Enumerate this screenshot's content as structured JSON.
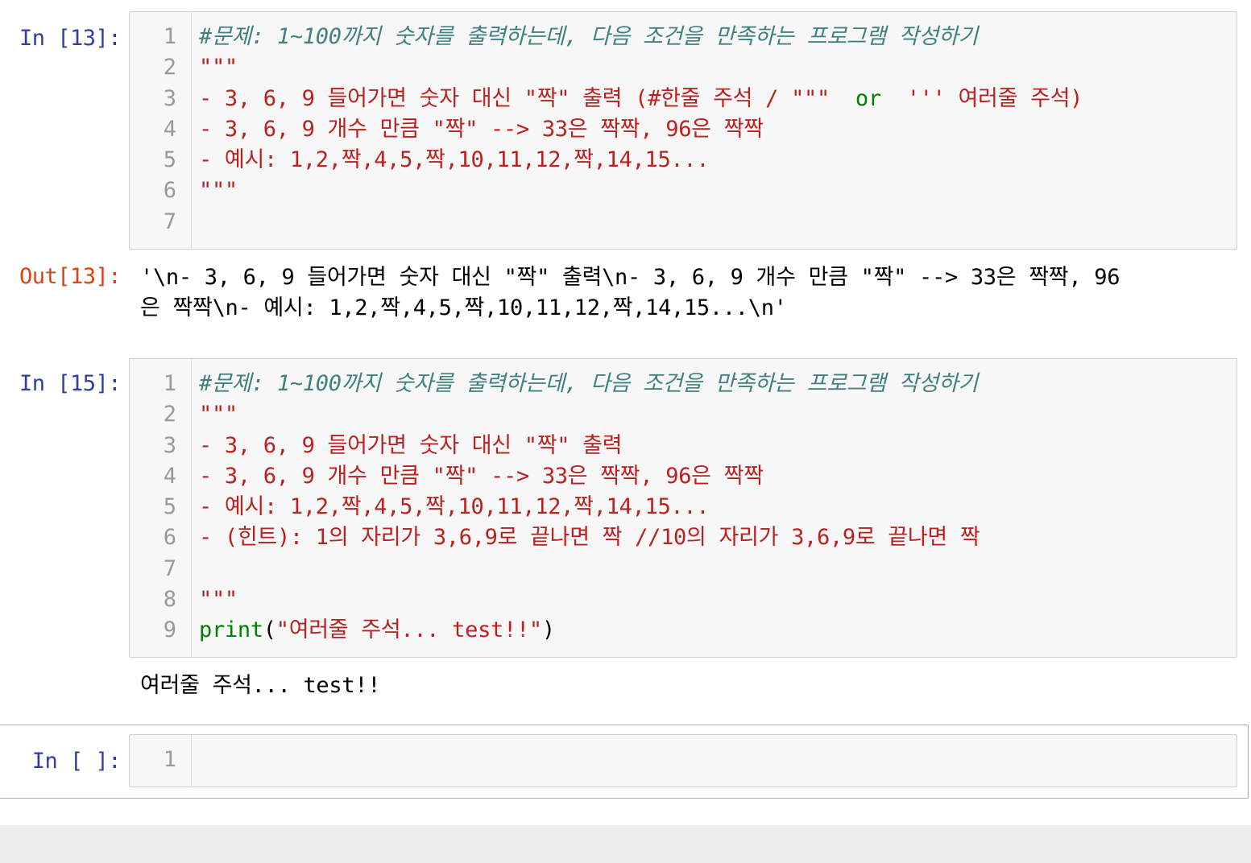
{
  "cells": [
    {
      "prompt": "In [13]:",
      "lines": [
        {
          "n": "1",
          "segments": [
            {
              "t": "#문제: 1~100까지 숫자를 출력하는데, 다음 조건을 만족하는 프로그램 작성하기",
              "c": "comment"
            }
          ]
        },
        {
          "n": "2",
          "segments": [
            {
              "t": "\"\"\"",
              "c": "string"
            }
          ]
        },
        {
          "n": "3",
          "segments": [
            {
              "t": "- 3, 6, 9 들어가면 숫자 대신 \"짝\" 출력 (#한줄 주석 / \"\"\"  ",
              "c": "string"
            },
            {
              "t": "or",
              "c": "green"
            },
            {
              "t": "  ''' 여러줄 주석)",
              "c": "string"
            }
          ]
        },
        {
          "n": "4",
          "segments": [
            {
              "t": "- 3, 6, 9 개수 만큼 \"짝\" --> 33은 짝짝, 96은 짝짝",
              "c": "string"
            }
          ]
        },
        {
          "n": "5",
          "segments": [
            {
              "t": "- 예시: 1,2,짝,4,5,짝,10,11,12,짝,14,15...",
              "c": "string"
            }
          ]
        },
        {
          "n": "6",
          "segments": [
            {
              "t": "\"\"\"",
              "c": "string"
            }
          ]
        },
        {
          "n": "7",
          "segments": []
        }
      ],
      "output_prompt": "Out[13]:",
      "output_lines": [
        "'\\n- 3, 6, 9 들어가면 숫자 대신 \"짝\" 출력\\n- 3, 6, 9 개수 만큼 \"짝\" --> 33은 짝짝, 96",
        "은 짝짝\\n- 예시: 1,2,짝,4,5,짝,10,11,12,짝,14,15...\\n'"
      ]
    },
    {
      "prompt": "In [15]:",
      "lines": [
        {
          "n": "1",
          "segments": [
            {
              "t": "#문제: 1~100까지 숫자를 출력하는데, 다음 조건을 만족하는 프로그램 작성하기",
              "c": "comment"
            }
          ]
        },
        {
          "n": "2",
          "segments": [
            {
              "t": "\"\"\"",
              "c": "string"
            }
          ]
        },
        {
          "n": "3",
          "segments": [
            {
              "t": "- 3, 6, 9 들어가면 숫자 대신 \"짝\" 출력",
              "c": "string"
            }
          ]
        },
        {
          "n": "4",
          "segments": [
            {
              "t": "- 3, 6, 9 개수 만큼 \"짝\" --> 33은 짝짝, 96은 짝짝",
              "c": "string"
            }
          ]
        },
        {
          "n": "5",
          "segments": [
            {
              "t": "- 예시: 1,2,짝,4,5,짝,10,11,12,짝,14,15...",
              "c": "string"
            }
          ]
        },
        {
          "n": "6",
          "segments": [
            {
              "t": "- (힌트): 1의 자리가 3,6,9로 끝나면 짝 //10의 자리가 3,6,9로 끝나면 짝",
              "c": "string"
            }
          ]
        },
        {
          "n": "7",
          "segments": []
        },
        {
          "n": "8",
          "segments": [
            {
              "t": "\"\"\"",
              "c": "string"
            }
          ]
        },
        {
          "n": "9",
          "segments": [
            {
              "t": "print",
              "c": "green"
            },
            {
              "t": "(",
              "c": "plain"
            },
            {
              "t": "\"여러줄 주석... test!!\"",
              "c": "string"
            },
            {
              "t": ")",
              "c": "plain"
            }
          ]
        }
      ],
      "stdout_lines": [
        "여러줄 주석... test!!"
      ]
    },
    {
      "prompt": "In [ ]:",
      "lines": [
        {
          "n": "1",
          "segments": []
        }
      ]
    }
  ],
  "colors": {
    "comment": "#408080",
    "string": "#ba2121",
    "keyword_green": "#008000",
    "in_prompt": "#303f9f",
    "out_prompt": "#d84315"
  }
}
